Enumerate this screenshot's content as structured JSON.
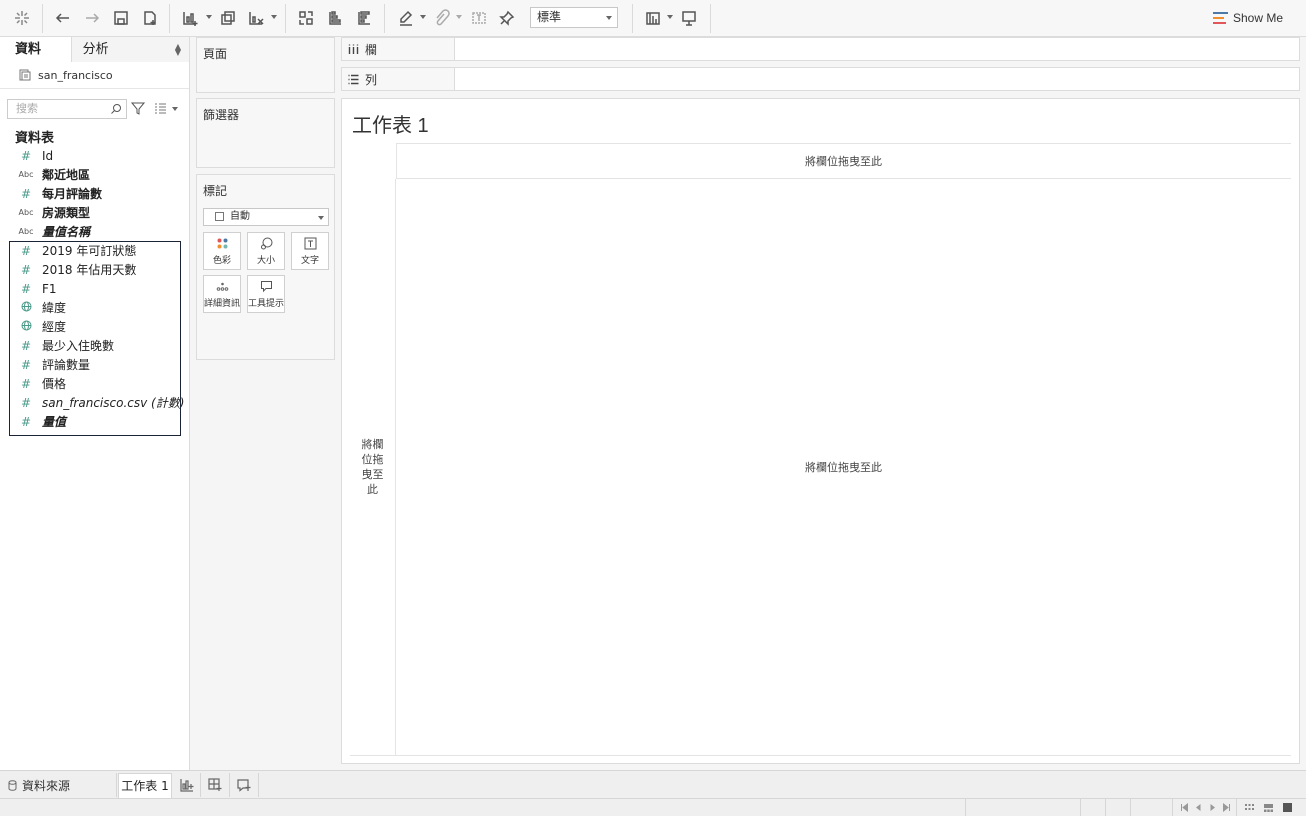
{
  "toolbar": {
    "fit_value": "標準",
    "show_me_label": "Show Me"
  },
  "data_pane": {
    "tabs": [
      {
        "label": "資料"
      },
      {
        "label": "分析"
      }
    ],
    "datasource_name": "san_francisco",
    "search_placeholder": "搜索",
    "section_title": "資料表",
    "fields": [
      {
        "icon": "hash",
        "type_label": "#",
        "name": "Id",
        "style": "normal"
      },
      {
        "icon": "abc",
        "type_label": "Abc",
        "name": "鄰近地區",
        "style": "bold"
      },
      {
        "icon": "hash",
        "type_label": "#",
        "name": "每月評論數",
        "style": "bold"
      },
      {
        "icon": "abc",
        "type_label": "Abc",
        "name": "房源類型",
        "style": "bold"
      },
      {
        "icon": "abc",
        "type_label": "Abc",
        "name": "量值名稱",
        "style": "bolditalic"
      },
      {
        "icon": "hash",
        "type_label": "#",
        "name": "2019 年可訂狀態",
        "style": "normal"
      },
      {
        "icon": "hash",
        "type_label": "#",
        "name": "2018 年佔用天數",
        "style": "normal"
      },
      {
        "icon": "hash",
        "type_label": "#",
        "name": "F1",
        "style": "normal"
      },
      {
        "icon": "globe",
        "type_label": "",
        "name": "緯度",
        "style": "normal"
      },
      {
        "icon": "globe",
        "type_label": "",
        "name": "經度",
        "style": "normal"
      },
      {
        "icon": "hash",
        "type_label": "#",
        "name": "最少入住晚數",
        "style": "normal"
      },
      {
        "icon": "hash",
        "type_label": "#",
        "name": "評論數量",
        "style": "normal"
      },
      {
        "icon": "hash",
        "type_label": "#",
        "name": "價格",
        "style": "normal"
      },
      {
        "icon": "hash",
        "type_label": "#",
        "name": "san_francisco.csv (計數)",
        "style": "italic"
      },
      {
        "icon": "hash",
        "type_label": "#",
        "name": "量值",
        "style": "bolditalic"
      }
    ]
  },
  "cards": {
    "pages_title": "頁面",
    "filters_title": "篩選器",
    "marks_title": "標記",
    "mark_type": "自動",
    "mark_buttons": [
      {
        "label": "色彩",
        "icon": "color-dots-icon"
      },
      {
        "label": "大小",
        "icon": "size-icon"
      },
      {
        "label": "文字",
        "icon": "text-icon"
      },
      {
        "label": "詳細資訊",
        "icon": "detail-icon"
      },
      {
        "label": "工具提示",
        "icon": "tooltip-icon"
      }
    ]
  },
  "shelves": {
    "columns_label": "欄",
    "rows_label": "列"
  },
  "view": {
    "title": "工作表 1",
    "drop_columns": "將欄位拖曳至此",
    "drop_rows": "將欄位拖曳至此",
    "drop_body": "將欄位拖曳至此"
  },
  "tabbar": {
    "datasource_tab": "資料來源",
    "sheet_tab": "工作表 1"
  },
  "colors": {
    "show_me_bars": [
      "#4e79a7",
      "#f28e2b",
      "#e15759"
    ],
    "field_icon": "#4a9a8a",
    "selection_border": "#1a2436"
  }
}
